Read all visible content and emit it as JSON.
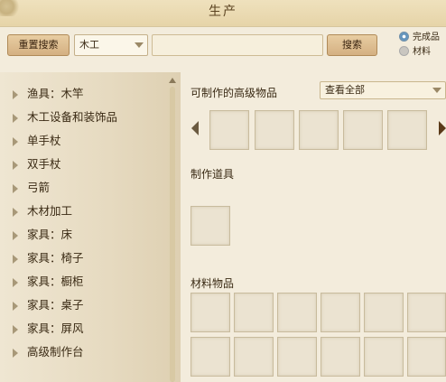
{
  "window": {
    "title": "生产"
  },
  "toolbar": {
    "reset_label": "重置搜索",
    "category_value": "木工",
    "search_value": "",
    "search_label": "搜索",
    "radio_finished": "完成品",
    "radio_material": "材料",
    "radio_selected": "完成品"
  },
  "sidebar": {
    "items": [
      {
        "label": "渔具：木竿"
      },
      {
        "label": "木工设备和装饰品"
      },
      {
        "label": "单手杖"
      },
      {
        "label": "双手杖"
      },
      {
        "label": "弓箭"
      },
      {
        "label": "木材加工"
      },
      {
        "label": "家具：床"
      },
      {
        "label": "家具：椅子"
      },
      {
        "label": "家具：橱柜"
      },
      {
        "label": "家具：桌子"
      },
      {
        "label": "家具：屏风"
      },
      {
        "label": "高级制作台"
      }
    ]
  },
  "main": {
    "craftable_title": "可制作的高级物品",
    "view_filter": "查看全部",
    "tools_title": "制作道具",
    "materials_title": "材料物品"
  },
  "colors": {
    "accent_button": "#d4b082",
    "panel_bg": "#f3ecdc",
    "radio_selected": "#5b8fb8"
  }
}
